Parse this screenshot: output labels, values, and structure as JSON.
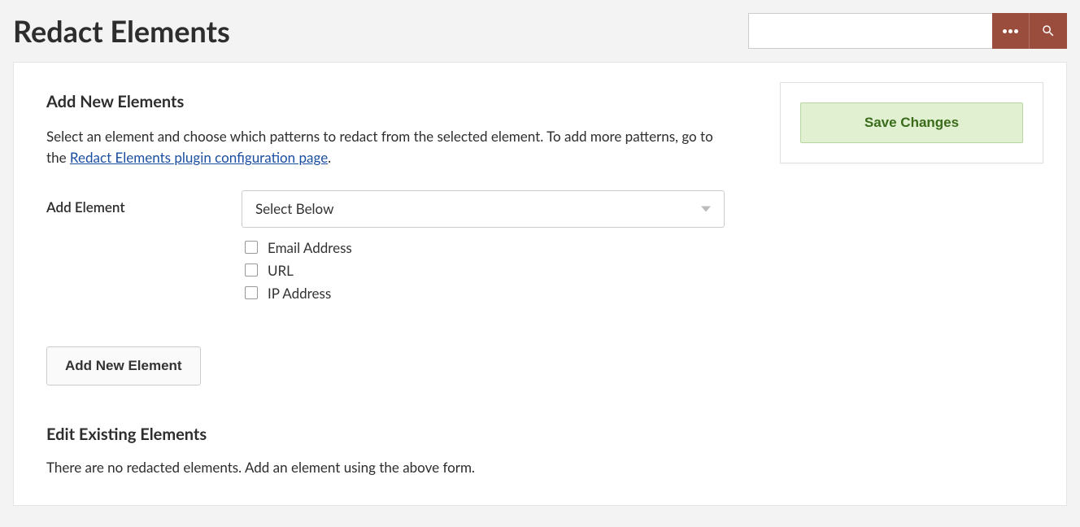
{
  "page": {
    "title": "Redact Elements"
  },
  "search": {
    "value": "",
    "placeholder": ""
  },
  "save": {
    "button_label": "Save Changes"
  },
  "add_section": {
    "title": "Add New Elements",
    "intro_prefix": "Select an element and choose which patterns to redact from the selected element. To add more patterns, go to the ",
    "intro_link": "Redact Elements plugin configuration page",
    "intro_suffix": ".",
    "label": "Add Element",
    "select_placeholder": "Select Below",
    "checkboxes": [
      {
        "label": "Email Address"
      },
      {
        "label": "URL"
      },
      {
        "label": "IP Address"
      }
    ],
    "add_button_label": "Add New Element"
  },
  "edit_section": {
    "title": "Edit Existing Elements",
    "empty_message": "There are no redacted elements. Add an element using the above form."
  }
}
